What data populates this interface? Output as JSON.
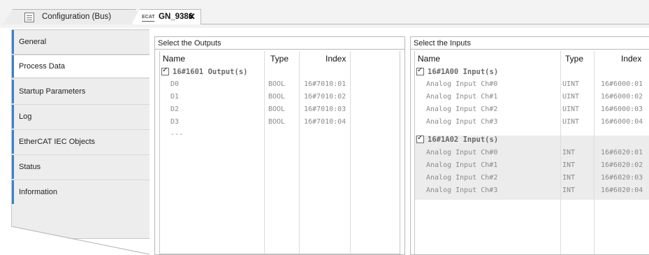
{
  "tabs": [
    {
      "label": "Configuration (Bus)",
      "icon": "config-table-icon"
    },
    {
      "label": "GN_9386",
      "icon": "ethercat-icon",
      "icon_text": "ECAT",
      "close": "✕",
      "active": true
    }
  ],
  "nav": {
    "items": [
      "General",
      "Process Data",
      "Startup Parameters",
      "Log",
      "EtherCAT IEC Objects",
      "Status",
      "Information"
    ],
    "active": "Process Data",
    "accent": "#3a82c9"
  },
  "outputs": {
    "title": "Select the Outputs",
    "headers": {
      "name": "Name",
      "type": "Type",
      "index": "Index"
    },
    "groups": [
      {
        "label": "16#1601 Output(s)",
        "checked": true,
        "rows": [
          {
            "name": "D0",
            "type": "BOOL",
            "index": "16#7010:01"
          },
          {
            "name": "D1",
            "type": "BOOL",
            "index": "16#7010:02"
          },
          {
            "name": "D2",
            "type": "BOOL",
            "index": "16#7010:03"
          },
          {
            "name": "D3",
            "type": "BOOL",
            "index": "16#7010:04"
          },
          {
            "name": "---",
            "type": "",
            "index": ""
          }
        ]
      }
    ]
  },
  "inputs": {
    "title": "Select the Inputs",
    "headers": {
      "name": "Name",
      "type": "Type",
      "index": "Index"
    },
    "groups": [
      {
        "label": "16#1A00 Input(s)",
        "checked": true,
        "rows": [
          {
            "name": "Analog Input Ch#0",
            "type": "UINT",
            "index": "16#6000:01"
          },
          {
            "name": "Analog Input Ch#1",
            "type": "UINT",
            "index": "16#6000:02"
          },
          {
            "name": "Analog Input Ch#2",
            "type": "UINT",
            "index": "16#6000:03"
          },
          {
            "name": "Analog Input Ch#3",
            "type": "UINT",
            "index": "16#6000:04"
          }
        ]
      },
      {
        "label": "16#1A02 Input(s)",
        "checked": true,
        "rows": [
          {
            "name": "Analog Input Ch#0",
            "type": "INT",
            "index": "16#6020:01"
          },
          {
            "name": "Analog Input Ch#1",
            "type": "INT",
            "index": "16#6020:02"
          },
          {
            "name": "Analog Input Ch#2",
            "type": "INT",
            "index": "16#6020:03"
          },
          {
            "name": "Analog Input Ch#3",
            "type": "INT",
            "index": "16#6020:04"
          }
        ]
      }
    ]
  }
}
